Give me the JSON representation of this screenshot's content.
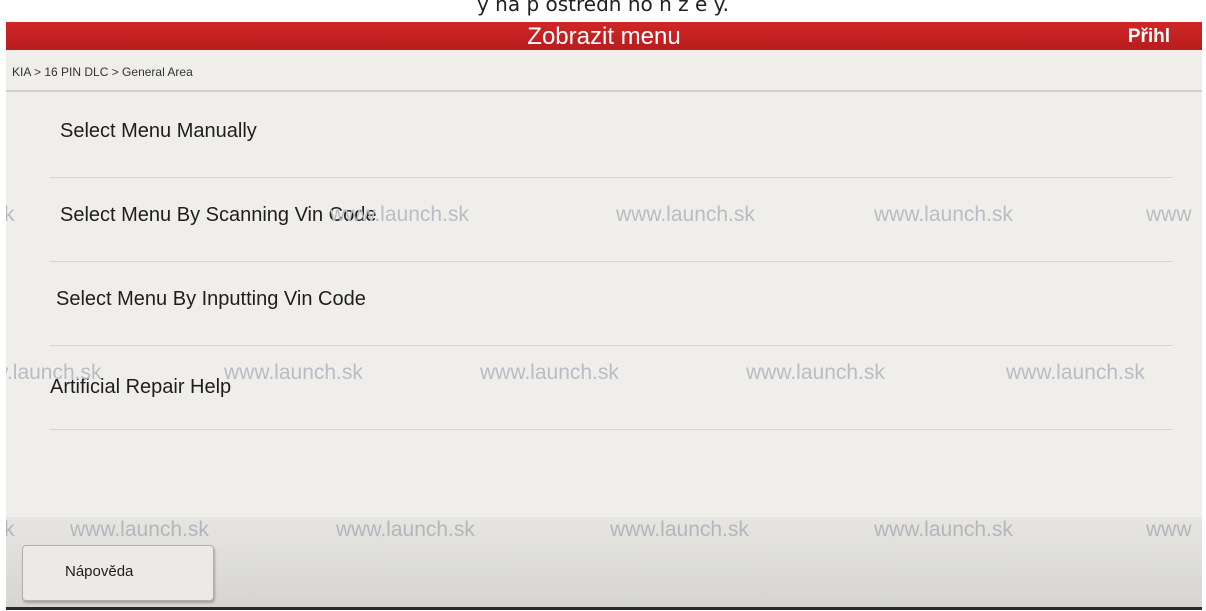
{
  "caption": {
    "text": "y na p ostredn ho n z e y."
  },
  "header": {
    "title": "Zobrazit menu",
    "login_label": "Přihl"
  },
  "breadcrumb": "KIA > 16 PIN DLC > General Area",
  "menu": {
    "items": [
      {
        "label": "Select Menu Manually"
      },
      {
        "label": "Select Menu By Scanning Vin Code"
      },
      {
        "label": "Select Menu By Inputting Vin Code"
      },
      {
        "label": "Artificial Repair Help"
      }
    ]
  },
  "footer": {
    "help_label": "Nápověda"
  },
  "watermark": {
    "text": "www.launch.sk",
    "rows": [
      [
        "ch.sk",
        "www.launch.sk",
        "www.launch.sk",
        "www.launch.sk",
        "www.launch.sk"
      ],
      [
        "k",
        "www.launch.sk",
        "www.launch.sk",
        "www.launch.sk",
        "www.launch.sk",
        "www"
      ],
      [
        "v.launch.sk",
        "www.launch.sk",
        "www.launch.sk",
        "www.launch.sk",
        "www.launch.sk"
      ],
      [
        "k",
        "www.launch.sk",
        "www.launch.sk",
        "www.launch.sk",
        "www.launch.sk",
        "www"
      ]
    ]
  },
  "colors": {
    "titlebar": "#c52222",
    "screen_background": "#efeeea",
    "watermark": "#b9bcc2"
  }
}
